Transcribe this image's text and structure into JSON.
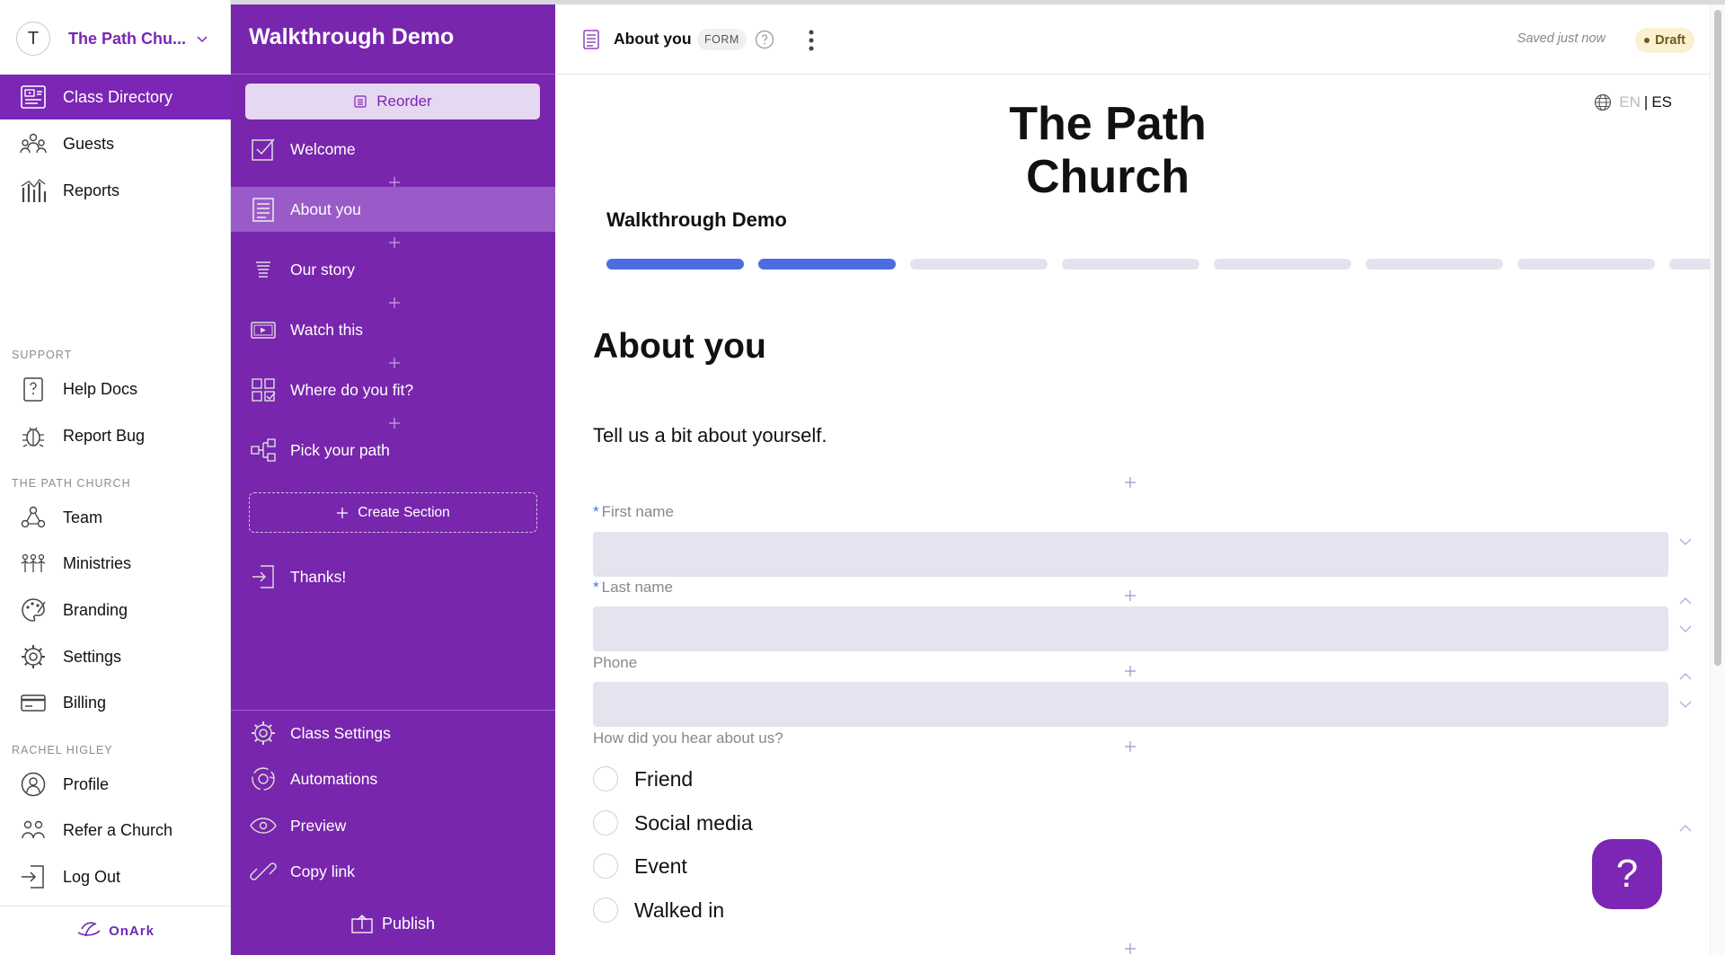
{
  "org": {
    "initial": "T",
    "name": "The Path Chu..."
  },
  "leftnav": {
    "main": [
      {
        "label": "Class Directory",
        "icon": "class-directory-icon",
        "active": true
      },
      {
        "label": "Guests",
        "icon": "guests-icon"
      },
      {
        "label": "Reports",
        "icon": "reports-icon"
      }
    ],
    "support_heading": "SUPPORT",
    "support": [
      {
        "label": "Help Docs",
        "icon": "help-docs-icon"
      },
      {
        "label": "Report Bug",
        "icon": "bug-icon"
      }
    ],
    "church_heading": "THE PATH CHURCH",
    "church": [
      {
        "label": "Team",
        "icon": "team-icon"
      },
      {
        "label": "Ministries",
        "icon": "ministries-icon"
      },
      {
        "label": "Branding",
        "icon": "palette-icon"
      },
      {
        "label": "Settings",
        "icon": "gear-icon"
      },
      {
        "label": "Billing",
        "icon": "credit-card-icon"
      }
    ],
    "user_heading": "RACHEL HIGLEY",
    "user": [
      {
        "label": "Profile",
        "icon": "profile-icon"
      },
      {
        "label": "Refer a Church",
        "icon": "refer-icon"
      },
      {
        "label": "Log Out",
        "icon": "logout-icon"
      }
    ],
    "logo_text": "OnArk"
  },
  "sections": {
    "title": "Walkthrough Demo",
    "reorder_label": "Reorder",
    "items": [
      {
        "label": "Welcome",
        "icon": "checkbox-icon"
      },
      {
        "label": "About you",
        "icon": "form-icon",
        "active": true
      },
      {
        "label": "Our story",
        "icon": "text-icon"
      },
      {
        "label": "Watch this",
        "icon": "video-icon"
      },
      {
        "label": "Where do you fit?",
        "icon": "grid-check-icon"
      },
      {
        "label": "Pick your path",
        "icon": "branch-icon"
      }
    ],
    "create_label": "Create Section",
    "thanks_label": "Thanks!",
    "bottom": [
      {
        "label": "Class Settings",
        "icon": "gear-icon"
      },
      {
        "label": "Automations",
        "icon": "automation-icon"
      },
      {
        "label": "Preview",
        "icon": "eye-icon"
      },
      {
        "label": "Copy link",
        "icon": "link-icon"
      }
    ],
    "publish_label": "Publish"
  },
  "topbar": {
    "title": "About you",
    "type_badge": "FORM",
    "saved_text": "Saved just now",
    "status": "Draft"
  },
  "preview": {
    "lang_en": "EN",
    "lang_sep": "|",
    "lang_es": "ES",
    "church_line1": "The Path",
    "church_line2": "Church",
    "form_title": "Walkthrough Demo",
    "progress": {
      "completed": 2,
      "total": 8
    },
    "page_title": "About you",
    "page_desc": "Tell us a bit about yourself.",
    "fields": [
      {
        "label": "First name",
        "required": true,
        "value": ""
      },
      {
        "label": "Last name",
        "required": true,
        "value": ""
      },
      {
        "label": "Phone",
        "required": false,
        "value": ""
      }
    ],
    "question": "How did you hear about us?",
    "options": [
      "Friend",
      "Social media",
      "Event",
      "Walked in"
    ]
  },
  "colors": {
    "brand_purple": "#7826ad",
    "accent_blue": "#4a6ee0",
    "draft_badge": "#fbf0cf"
  }
}
